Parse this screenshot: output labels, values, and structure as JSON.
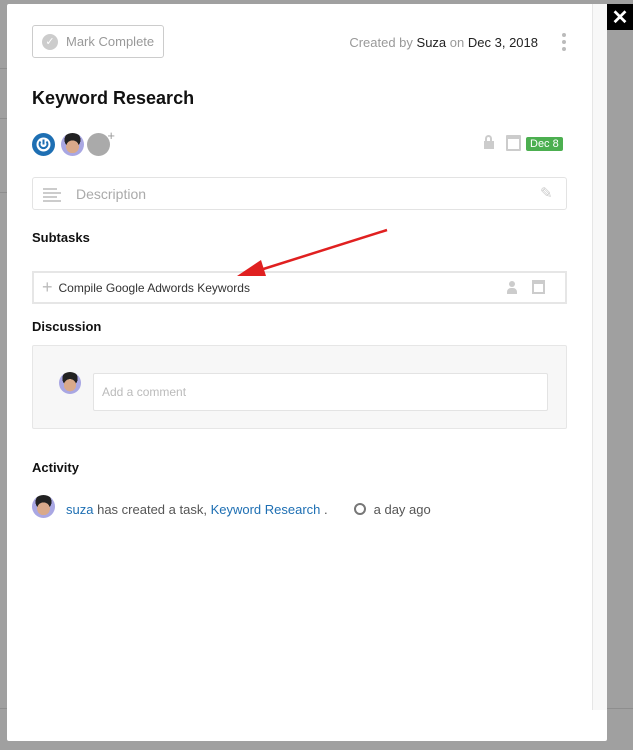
{
  "header": {
    "mark_complete": "Mark Complete",
    "created_prefix": "Created by",
    "creator": "Suza",
    "on": "on",
    "created_date": "Dec 3, 2018"
  },
  "task": {
    "title": "Keyword Research",
    "due_badge": "Dec 8",
    "due_color": "#4caf50",
    "description_placeholder": "Description"
  },
  "subtasks": {
    "heading": "Subtasks",
    "input_value": "Compile Google Adwords Keywords"
  },
  "discussion": {
    "heading": "Discussion",
    "placeholder": "Add a comment"
  },
  "activity": {
    "heading": "Activity",
    "items": [
      {
        "user": "suza",
        "text": "has created a task,",
        "link": "Keyword Research",
        "suffix": ".",
        "time": "a day ago"
      }
    ]
  },
  "close": "✕"
}
